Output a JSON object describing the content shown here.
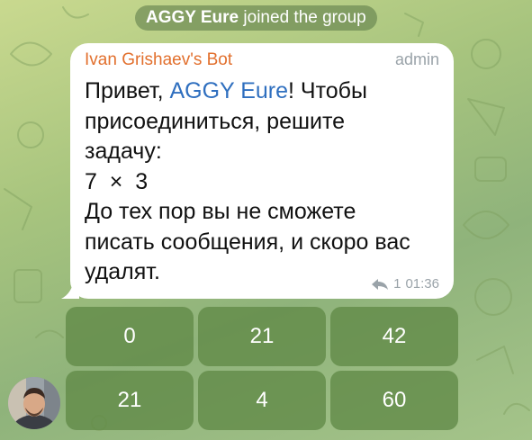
{
  "service_message": {
    "name": "AGGY Eure",
    "text": "joined the group"
  },
  "message": {
    "sender": "Ivan Grishaev's Bot",
    "role": "admin",
    "lines": [
      "Привет, ",
      "AGGY Eure",
      "! Чтобы\nприсоединиться, решите\nзадачу:\n7  ×  3\nДо тех пор вы не сможете\nписать сообщения, и скоро вас\nудалят."
    ],
    "replies": "1",
    "time": "01:36"
  },
  "keyboard": [
    [
      "0",
      "21",
      "42"
    ],
    [
      "21",
      "4",
      "60"
    ]
  ],
  "colors": {
    "sender": "#e2702e",
    "mention": "#2f6fbf",
    "button_bg": "#608946"
  }
}
